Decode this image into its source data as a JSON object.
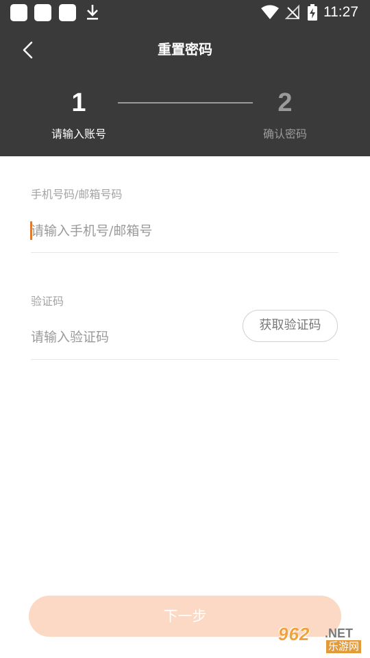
{
  "status_bar": {
    "time": "11:27",
    "icons": [
      "notification-square-icon",
      "notification-square-icon",
      "notification-square-icon",
      "download-icon",
      "wifi-icon",
      "no-signal-icon",
      "battery-charging-icon"
    ]
  },
  "header": {
    "title": "重置密码",
    "back_icon": "chevron-left-icon",
    "background_color": "#3a3a3a"
  },
  "steps": [
    {
      "number": "1",
      "label": "请输入账号",
      "active": true
    },
    {
      "number": "2",
      "label": "确认密码",
      "active": false
    }
  ],
  "form": {
    "account": {
      "label": "手机号码/邮箱号码",
      "placeholder": "请输入手机号/邮箱号",
      "value": ""
    },
    "code": {
      "label": "验证码",
      "placeholder": "请输入验证码",
      "value": "",
      "get_code_label": "获取验证码"
    }
  },
  "next_button": {
    "label": "下一步",
    "color": "#fcd9c4"
  },
  "watermark": {
    "main": "962",
    "suffix": ".NET",
    "sub": "乐游网"
  },
  "colors": {
    "accent": "#e07a2e",
    "header": "#3a3a3a",
    "button_disabled": "#fcd9c4"
  }
}
